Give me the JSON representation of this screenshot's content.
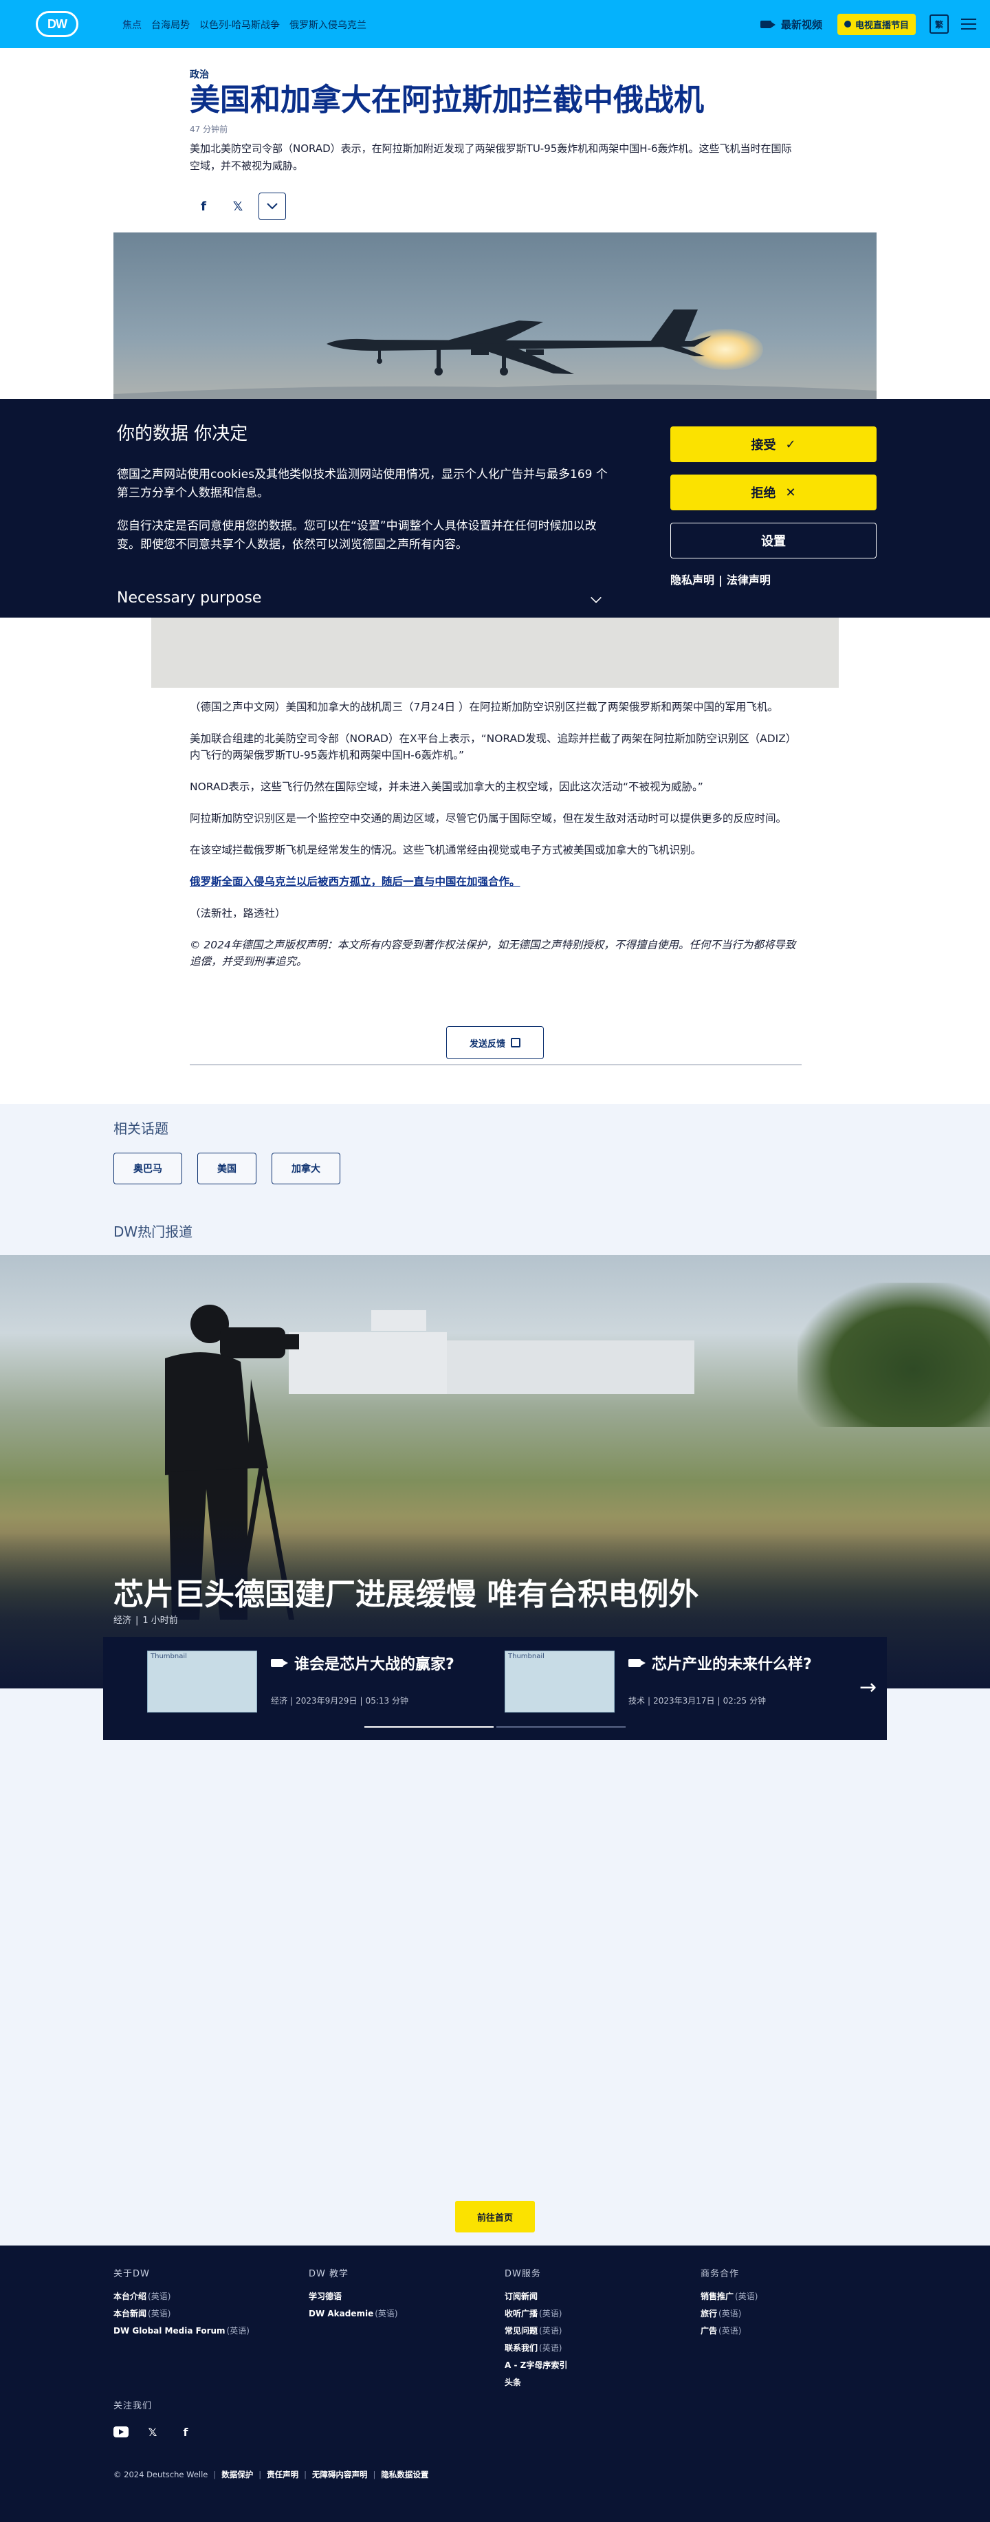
{
  "header": {
    "logo": "DW",
    "nav": [
      "焦点",
      "台海局势",
      "以色列-哈马斯战争",
      "俄罗斯入侵乌克兰"
    ],
    "video_label": "最新视频",
    "tv_label": "电视直播节目",
    "lang_label": "繁"
  },
  "article": {
    "kicker": "政治",
    "headline": "美国和加拿大在阿拉斯加拦截中俄战机",
    "ago": "47 分钟前",
    "lead": "美加北美防空司令部（NORAD）表示，在阿拉斯加附近发现了两架俄罗斯TU-95轰炸机和两架中国H-6轰炸机。这些飞机当时在国际空域，并不被视为威胁。",
    "paragraphs": [
      "（德国之声中文网）美国和加拿大的战机周三（7月24日 ）在阿拉斯加防空识别区拦截了两架俄罗斯和两架中国的军用飞机。",
      "美加联合组建的北美防空司令部（NORAD）在X平台上表示，“NORAD发现、追踪并拦截了两架在阿拉斯加防空识别区（ADIZ）内飞行的两架俄罗斯TU-95轰炸机和两架中国H-6轰炸机。”",
      "NORAD表示，这些飞行仍然在国际空域，并未进入美国或加拿大的主权空域，因此这次活动“不被视为威胁。”",
      "阿拉斯加防空识别区是一个监控空中交通的周边区域，尽管它仍属于国际空域，但在发生敌对活动时可以提供更多的反应时间。",
      "在该空域拦截俄罗斯飞机是经常发生的情况。这些飞机通常经由视觉或电子方式被美国或加拿大的飞机识别。"
    ],
    "link_text": "俄罗斯全面入侵乌克兰以后被西方孤立，随后一直与中国在加强合作。",
    "source": "（法新社，路透社）",
    "copyright": "© 2024年德国之声版权声明：本文所有内容受到著作权法保护，如无德国之声特别授权，不得擅自使用。任何不当行为都将导致追偿，并受到刑事追究。",
    "feedback_label": "发送反馈"
  },
  "cookie": {
    "title": "你的数据 你决定",
    "p1": "德国之声网站使用cookies及其他类似技术监测网站使用情况，显示个人化广告并与最多169 个第三方分享个人数据和信息。",
    "p2": "您自行决定是否同意使用您的数据。您可以在“设置”中调整个人具体设置并在任何时候加以改变。即使您不同意共享个人数据，依然可以浏览德国之声所有内容。",
    "necessary": "Necessary purpose",
    "accept": "接受",
    "reject": "拒绝",
    "settings": "设置",
    "privacy": "隐私声明",
    "legal": "法律声明"
  },
  "related": {
    "title": "相关话题",
    "tags": [
      "奥巴马",
      "美国",
      "加拿大"
    ]
  },
  "hot": {
    "title": "DW热门报道",
    "feature_title": "芯片巨头德国建厂进展缓慢 唯有台积电例外",
    "feature_category": "经济",
    "feature_time": "1 小时前",
    "cards": [
      {
        "title": "谁会是芯片大战的赢家?",
        "category": "经济",
        "date": "2023年9月29日",
        "duration": "05:13 分钟",
        "alt": "Thumbnail"
      },
      {
        "title": "芯片产业的未来什么样?",
        "category": "技术",
        "date": "2023年3月17日",
        "duration": "02:25 分钟",
        "alt": "Thumbnail"
      }
    ]
  },
  "home_button": "前往首页",
  "footer": {
    "col1": {
      "title": "关于DW",
      "items": [
        {
          "t": "本台介绍",
          "en": "(英语)"
        },
        {
          "t": "本台新闻",
          "en": "(英语)"
        },
        {
          "t": "DW Global Media Forum",
          "en": "(英语)"
        }
      ]
    },
    "col2": {
      "title": "DW 教学",
      "items": [
        {
          "t": "学习德语",
          "en": ""
        },
        {
          "t": "DW Akademie",
          "en": "(英语)"
        }
      ]
    },
    "col3": {
      "title": "DW服务",
      "items": [
        {
          "t": "订阅新闻",
          "en": ""
        },
        {
          "t": "收听广播",
          "en": "(英语)"
        },
        {
          "t": "常见问题",
          "en": "(英语)"
        },
        {
          "t": "联系我们",
          "en": "(英语)"
        },
        {
          "t": "A - Z字母序索引",
          "en": ""
        },
        {
          "t": "头条",
          "en": ""
        }
      ]
    },
    "col4": {
      "title": "商务合作",
      "items": [
        {
          "t": "销售推广",
          "en": "(英语)"
        },
        {
          "t": "旅行",
          "en": "(英语)"
        },
        {
          "t": "广告",
          "en": "(英语)"
        }
      ]
    },
    "follow": "关注我们",
    "copyright": "© 2024 Deutsche Welle",
    "links": [
      "数据保护",
      "责任声明",
      "无障碍内容声明",
      "隐私数据设置"
    ]
  }
}
